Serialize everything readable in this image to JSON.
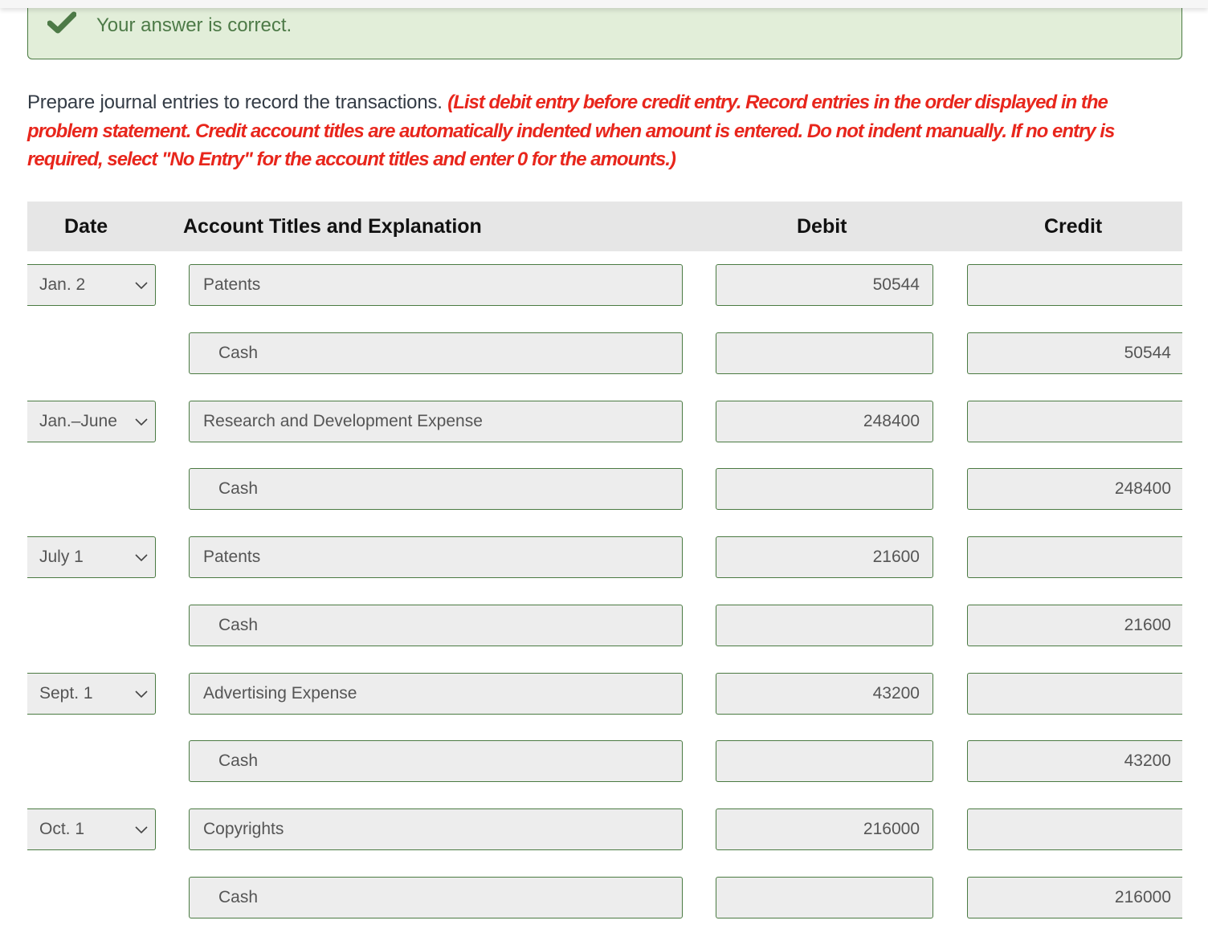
{
  "feedback": {
    "icon": "checkmark-icon",
    "message": "Your answer is correct.",
    "color": "#4d7a47",
    "background": "#e2eed9"
  },
  "instructions": {
    "text": "Prepare journal entries to record the transactions. ",
    "note": "(List debit entry before credit entry. Record entries in the order displayed in the problem statement. Credit account titles are automatically indented when amount is entered. Do not indent manually. If no entry is required, select \"No Entry\" for the account titles and enter 0 for the amounts.)",
    "note_color": "#e8261c"
  },
  "table": {
    "headers": {
      "date": "Date",
      "account": "Account Titles and Explanation",
      "debit": "Debit",
      "credit": "Credit"
    },
    "rows": [
      {
        "date": "Jan. 2",
        "account": "Patents",
        "debit": "50544",
        "credit": ""
      },
      {
        "date": "",
        "account": "Cash",
        "debit": "",
        "credit": "50544"
      },
      {
        "date": "Jan.–June",
        "account": "Research and Development Expense",
        "debit": "248400",
        "credit": ""
      },
      {
        "date": "",
        "account": "Cash",
        "debit": "",
        "credit": "248400"
      },
      {
        "date": "July 1",
        "account": "Patents",
        "debit": "21600",
        "credit": ""
      },
      {
        "date": "",
        "account": "Cash",
        "debit": "",
        "credit": "21600"
      },
      {
        "date": "Sept. 1",
        "account": "Advertising Expense",
        "debit": "43200",
        "credit": ""
      },
      {
        "date": "",
        "account": "Cash",
        "debit": "",
        "credit": "43200"
      },
      {
        "date": "Oct. 1",
        "account": "Copyrights",
        "debit": "216000",
        "credit": ""
      },
      {
        "date": "",
        "account": "Cash",
        "debit": "",
        "credit": "216000"
      }
    ]
  }
}
